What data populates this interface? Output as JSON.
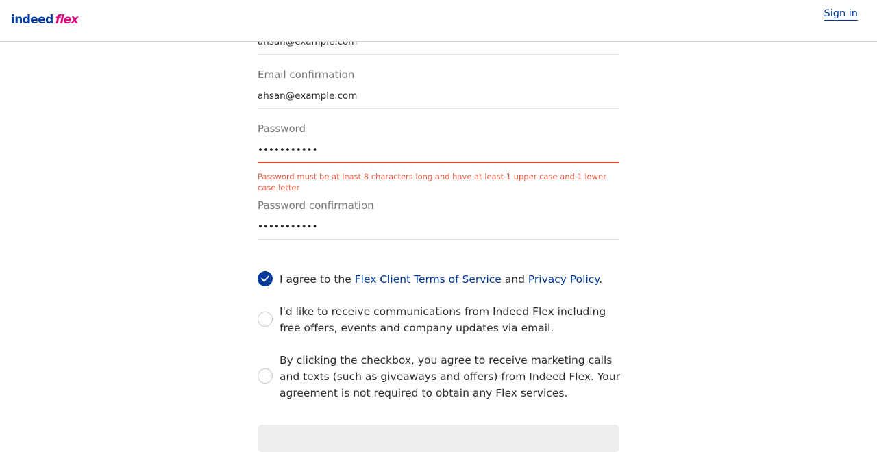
{
  "header": {
    "logo_indeed": "indeed",
    "logo_flex": "flex",
    "signin_label": "Sign in"
  },
  "form": {
    "email_value": "ahsan@example.com",
    "email_confirmation_label": "Email confirmation",
    "email_confirmation_value": "ahsan@example.com",
    "password_label": "Password",
    "password_value": "•••••••••••",
    "password_error": "Password must be at least 8 characters long and have at least 1 upper case and 1 lower case letter",
    "password_confirmation_label": "Password confirmation",
    "password_confirmation_value": "•••••••••••"
  },
  "agreements": {
    "terms": {
      "checked": true,
      "prefix": "I agree to the ",
      "terms_link": "Flex Client Terms of Service",
      "middle": " and ",
      "privacy_link": "Privacy Policy",
      "suffix": "."
    },
    "communications": {
      "checked": false,
      "text": "I'd like to receive communications from Indeed Flex including free offers, events and company updates via email."
    },
    "marketing": {
      "checked": false,
      "text": "By clicking the checkbox, you agree to receive marketing calls and texts (such as giveaways and offers) from Indeed Flex. Your agreement is not required to obtain any Flex services."
    }
  },
  "colors": {
    "brand_blue": "#003a9b",
    "brand_pink": "#e6007e",
    "error_red": "#ec5b3f"
  }
}
